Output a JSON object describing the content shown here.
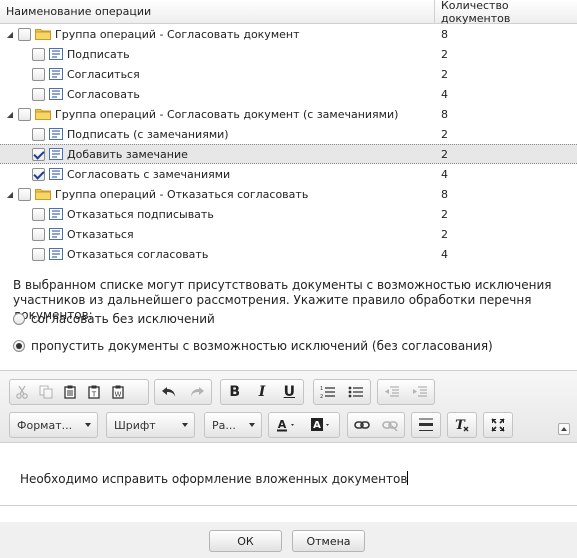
{
  "grid": {
    "header": {
      "name": "Наименование операции",
      "count": "Количество документов"
    },
    "rows": [
      {
        "level": 0,
        "type": "group",
        "checked": false,
        "label": "Группа операций - Согласовать документ",
        "count": "8"
      },
      {
        "level": 1,
        "type": "op",
        "checked": false,
        "label": "Подписать",
        "count": "2"
      },
      {
        "level": 1,
        "type": "op",
        "checked": false,
        "label": "Согласиться",
        "count": "2"
      },
      {
        "level": 1,
        "type": "op",
        "checked": false,
        "label": "Согласовать",
        "count": "4"
      },
      {
        "level": 0,
        "type": "group",
        "checked": false,
        "label": "Группа операций - Согласовать документ (с замечаниями)",
        "count": "8"
      },
      {
        "level": 1,
        "type": "op",
        "checked": false,
        "label": "Подписать (с замечаниями)",
        "count": "2"
      },
      {
        "level": 1,
        "type": "op",
        "checked": true,
        "selected": true,
        "label": "Добавить замечание",
        "count": "2"
      },
      {
        "level": 1,
        "type": "op",
        "checked": true,
        "label": "Согласовать с замечаниями",
        "count": "4"
      },
      {
        "level": 0,
        "type": "group",
        "checked": false,
        "label": "Группа операций - Отказаться согласовать",
        "count": "8"
      },
      {
        "level": 1,
        "type": "op",
        "checked": false,
        "label": "Отказаться подписывать",
        "count": "2"
      },
      {
        "level": 1,
        "type": "op",
        "checked": false,
        "label": "Отказаться",
        "count": "2"
      },
      {
        "level": 1,
        "type": "op",
        "checked": false,
        "label": "Отказаться согласовать",
        "count": "4"
      }
    ]
  },
  "info": {
    "text": "В выбранном списке могут присутствовать документы с возможностью исключения участников из дальнейшего рассмотрения. Укажите правило обработки перечня документов:",
    "option1": "согласовать без исключений",
    "option2": "пропустить документы с возможностью исключений (без согласования)",
    "selected": "option2"
  },
  "editor": {
    "format_combo": "Формат...",
    "font_combo": "Шрифт",
    "size_combo": "Ра...",
    "content": "Необходимо исправить оформление вложенных документов"
  },
  "footer": {
    "ok": "ОК",
    "cancel": "Отмена"
  },
  "colors": {
    "selected_row": "#e7e7e7",
    "folder": "#f4c84a",
    "doc_icon": "#4a6fb5"
  }
}
